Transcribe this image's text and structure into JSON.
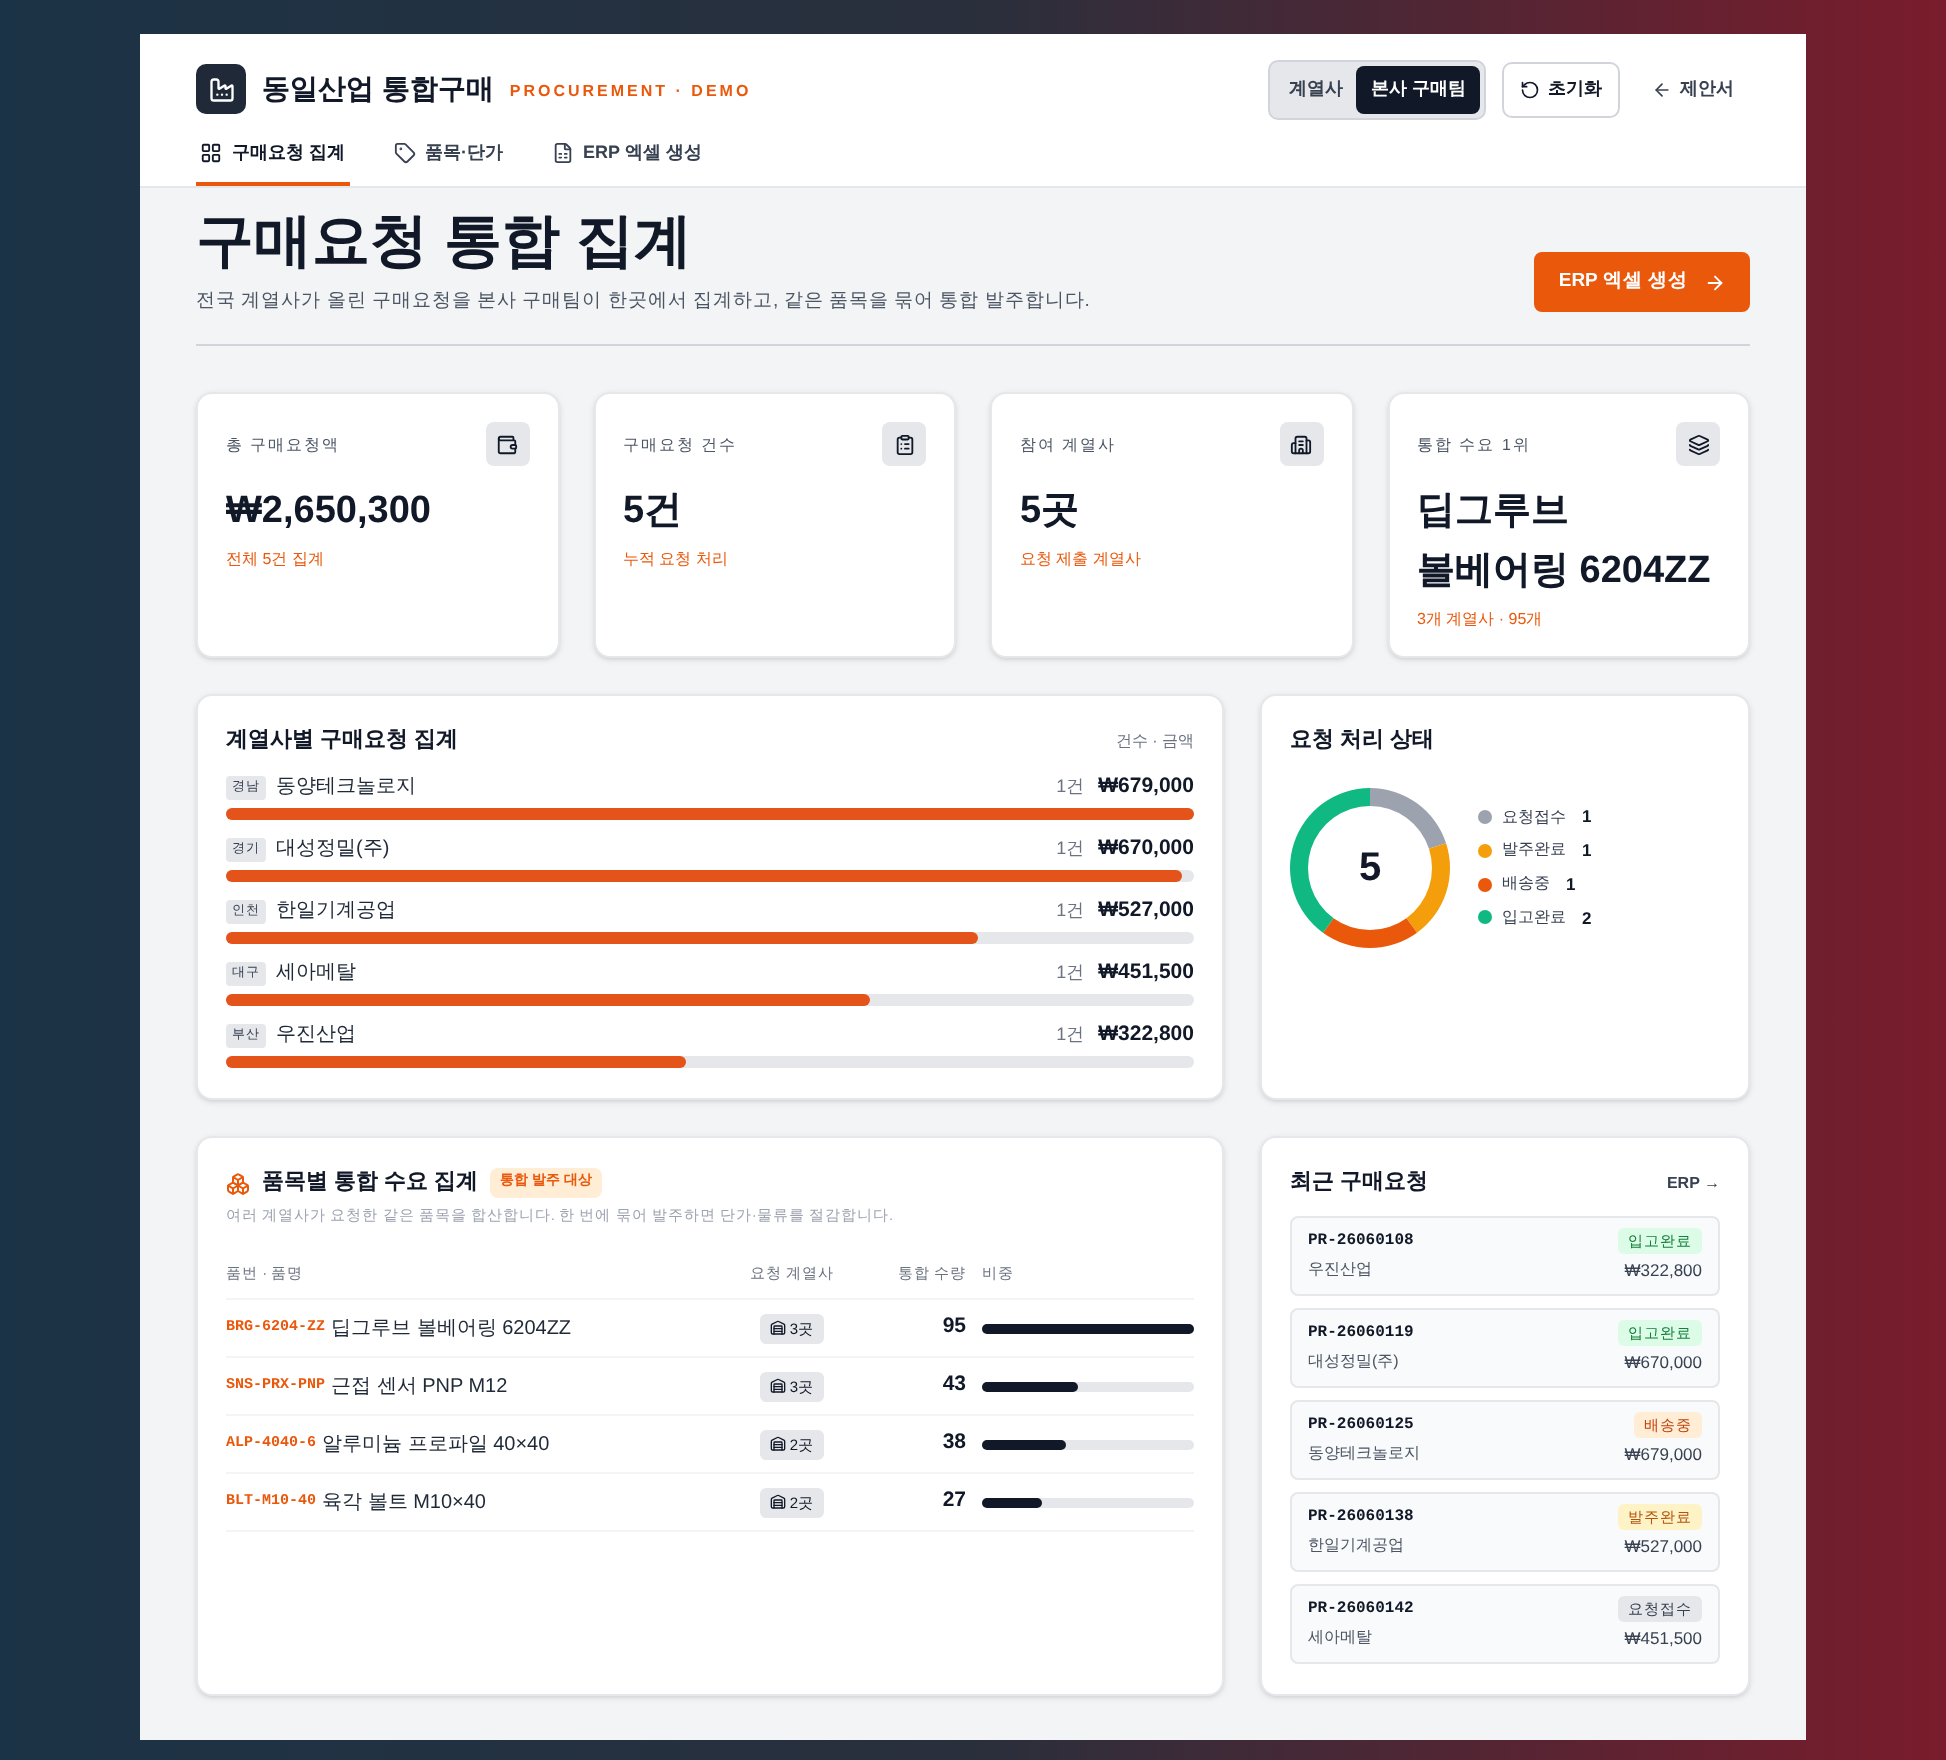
{
  "brand": {
    "name": "동일산업 통합구매",
    "tagline": "PROCUREMENT · DEMO"
  },
  "view_toggle": [
    {
      "label": "계열사",
      "selected": false
    },
    {
      "label": "본사 구매팀",
      "selected": true
    }
  ],
  "reset_button": "초기화",
  "back_link": "제안서",
  "tabs": [
    {
      "label": "구매요청 집계",
      "selected": true
    },
    {
      "label": "품목·단가",
      "selected": false
    },
    {
      "label": "ERP 엑셀 생성",
      "selected": false
    }
  ],
  "page": {
    "title": "구매요청 통합 집계",
    "subtitle": "전국 계열사가 올린 구매요청을 본사 구매팀이 한곳에서 집계하고, 같은 품목을 묶어 통합 발주합니다.",
    "action": "ERP 엑셀 생성"
  },
  "kpis": [
    {
      "label": "총 구매요청액",
      "value": "₩2,650,300",
      "note": "전체 5건 집계"
    },
    {
      "label": "구매요청 건수",
      "value": "5건",
      "note": "누적 요청 처리"
    },
    {
      "label": "참여 계열사",
      "value": "5곳",
      "note": "요청 제출 계열사"
    },
    {
      "label": "통합 수요 1위",
      "value": "딥그루브 볼베어링 6204ZZ",
      "note": "3개 계열사 · 95개"
    }
  ],
  "affiliates": {
    "title": "계열사별 구매요청 집계",
    "legend": "건수 · 금액",
    "rows": [
      {
        "region": "경남",
        "name": "동양테크놀로지",
        "count": "1건",
        "amount": "₩679,000",
        "level": 1
      },
      {
        "region": "경기",
        "name": "대성정밀(주)",
        "count": "1건",
        "amount": "₩670,000",
        "level": 0.987
      },
      {
        "region": "인천",
        "name": "한일기계공업",
        "count": "1건",
        "amount": "₩527,000",
        "level": 0.776
      },
      {
        "region": "대구",
        "name": "세아메탈",
        "count": "1건",
        "amount": "₩451,500",
        "level": 0.665
      },
      {
        "region": "부산",
        "name": "우진산업",
        "count": "1건",
        "amount": "₩322,800",
        "level": 0.475
      }
    ]
  },
  "status": {
    "title": "요청 처리 상태",
    "center_label": "5",
    "legend": [
      {
        "label": "요청접수",
        "count": "1",
        "color": "#9ca3af"
      },
      {
        "label": "발주완료",
        "count": "1",
        "color": "#f59e0b"
      },
      {
        "label": "배송중",
        "count": "1",
        "color": "#ea580c"
      },
      {
        "label": "입고완료",
        "count": "2",
        "color": "#10b981"
      }
    ]
  },
  "items": {
    "title": "품목별 통합 수요 집계",
    "badge": "통합 발주 대상",
    "subtitle": "여러 계열사가 요청한 같은 품목을 합산합니다. 한 번에 묶어 발주하면 단가·물류를 절감합니다.",
    "columns": [
      "품번 · 품명",
      "요청 계열사",
      "통합 수량",
      "비중"
    ],
    "rows": [
      {
        "code": "BRG-6204-ZZ",
        "name": "딥그루브 볼베어링 6204ZZ",
        "affiliates": "3곳",
        "qty": "95",
        "level": 1
      },
      {
        "code": "SNS-PRX-PNP",
        "name": "근접 센서 PNP M12",
        "affiliates": "3곳",
        "qty": "43",
        "level": 0.45
      },
      {
        "code": "ALP-4040-6",
        "name": "알루미늄 프로파일 40×40",
        "affiliates": "2곳",
        "qty": "38",
        "level": 0.4
      },
      {
        "code": "BLT-M10-40",
        "name": "육각 볼트 M10×40",
        "affiliates": "2곳",
        "qty": "27",
        "level": 0.28
      }
    ]
  },
  "recent": {
    "title": "최근 구매요청",
    "link": "ERP →",
    "rows": [
      {
        "id": "PR-26060108",
        "affiliate": "우진산업",
        "status": "입고완료",
        "kind": "stocked",
        "amount": "₩322,800"
      },
      {
        "id": "PR-26060119",
        "affiliate": "대성정밀(주)",
        "status": "입고완료",
        "kind": "stocked",
        "amount": "₩670,000"
      },
      {
        "id": "PR-26060125",
        "affiliate": "동양테크놀로지",
        "status": "배송중",
        "kind": "shipping",
        "amount": "₩679,000"
      },
      {
        "id": "PR-26060138",
        "affiliate": "한일기계공업",
        "status": "발주완료",
        "kind": "ordered",
        "amount": "₩527,000"
      },
      {
        "id": "PR-26060142",
        "affiliate": "세아메탈",
        "status": "요청접수",
        "kind": "received",
        "amount": "₩451,500"
      }
    ]
  }
}
